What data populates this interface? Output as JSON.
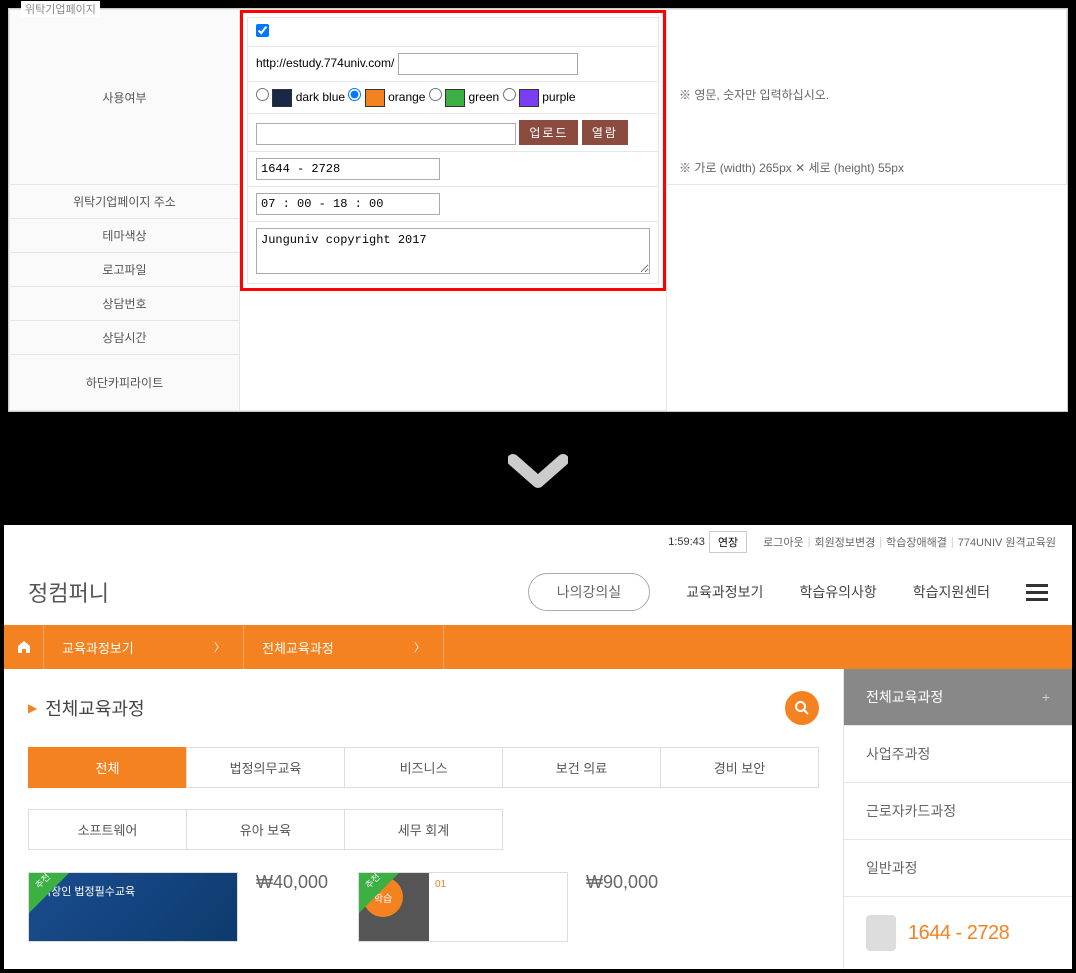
{
  "form": {
    "legend": "위탁기업페이지",
    "rows": {
      "use_label": "사용여부",
      "url_label": "위탁기업페이지 주소",
      "url_prefix": "http://estudy.774univ.com/",
      "url_hint": "※ 영문, 숫자만 입력하십시오.",
      "theme_label": "테마색상",
      "themes": [
        {
          "name": "dark blue",
          "color": "#1a2847"
        },
        {
          "name": "orange",
          "color": "#f58220"
        },
        {
          "name": "green",
          "color": "#3cb043"
        },
        {
          "name": "purple",
          "color": "#7b3ff2"
        }
      ],
      "logo_label": "로고파일",
      "btn_upload": "업로드",
      "btn_browse": "열람",
      "logo_hint": "※ 가로 (width) 265px ✕ 세로 (height) 55px",
      "tel_label": "상담번호",
      "tel_value": "1644 - 2728",
      "hours_label": "상담시간",
      "hours_value": "07 : 00 - 18 : 00",
      "copyright_label": "하단카피라이트",
      "copyright_value": "Junguniv copyright 2017"
    }
  },
  "site": {
    "utility": {
      "timer": "1:59:43",
      "extend": "연장",
      "links": [
        "로그아웃",
        "회원정보변경",
        "학습장애해결",
        "774UNIV 원격교육원"
      ]
    },
    "logo": "정컴퍼니",
    "header_btn": "나의강의실",
    "header_links": [
      "교육과정보기",
      "학습유의사항",
      "학습지원센터"
    ],
    "nav": [
      "교육과정보기",
      "전체교육과정"
    ],
    "page_title": "전체교육과정",
    "tabs_row1": [
      "전체",
      "법정의무교육",
      "비즈니스",
      "보건 의료",
      "경비 보안"
    ],
    "tabs_row2": [
      "소프트웨어",
      "유아 보육",
      "세무 회계"
    ],
    "courses": [
      {
        "thumb_text": "직장인 법정필수교육",
        "price": "₩40,000"
      },
      {
        "thumb_text": "01",
        "price": "₩90,000"
      }
    ],
    "sidebar": {
      "head": "전체교육과정",
      "items": [
        "사업주과정",
        "근로자카드과정",
        "일반과정"
      ],
      "phone": "1644 - 2728"
    }
  }
}
